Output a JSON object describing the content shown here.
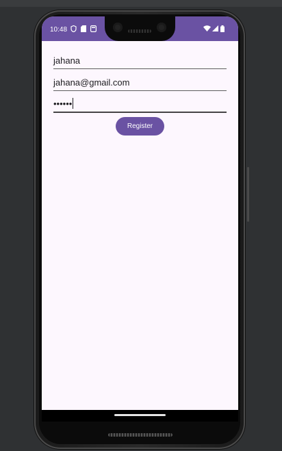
{
  "status_bar": {
    "time": "10:48",
    "left_icons": [
      "shield-icon",
      "sim-card-icon",
      "notification-box-icon"
    ],
    "right_icons": [
      "wifi-icon",
      "signal-icon",
      "battery-icon"
    ],
    "color": "#6a52a3"
  },
  "form": {
    "name_value": "jahana",
    "email_value": "jahana@gmail.com",
    "password_value": "••••••",
    "register_label": "Register"
  },
  "colors": {
    "accent": "#6a52a3",
    "background": "#fdf7fe"
  }
}
